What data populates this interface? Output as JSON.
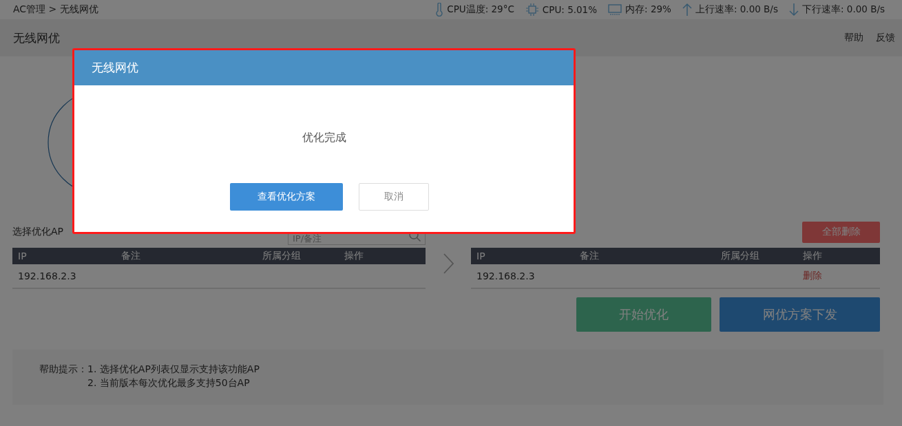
{
  "breadcrumb": "AC管理 > 无线网优",
  "status": [
    {
      "text": "CPU温度: 29°C"
    },
    {
      "text": "CPU: 5.01%"
    },
    {
      "text": "内存: 29%"
    },
    {
      "text": "上行速率: 0.00 B/s"
    },
    {
      "text": "下行速率: 0.00 B/s"
    }
  ],
  "page_title": "无线网优",
  "header_links": [
    "帮助",
    "反馈"
  ],
  "left_panel": {
    "title": "选择优化AP",
    "search": {
      "placeholder": "IP/备注"
    },
    "table": {
      "columns": [
        "IP",
        "备注",
        "所属分组",
        "操作"
      ],
      "rows": [
        {
          "ip": "192.168.2.3"
        }
      ]
    }
  },
  "right_panel": {
    "delete_all_button": "全部删除",
    "table": {
      "columns": [
        "IP",
        "备注",
        "所属分组",
        "操作"
      ],
      "rows": [
        {
          "ip": "192.168.2.3",
          "action": "删除"
        }
      ]
    }
  },
  "action_buttons": [
    {
      "label": "开始优化",
      "kind": "green"
    },
    {
      "label": "网优方案下发",
      "kind": "blue"
    }
  ],
  "help": {
    "label": "帮助提示：",
    "lines": [
      "1. 选择优化AP列表仅显示支持该功能AP",
      "2. 当前版本每次优化最多支持50台AP"
    ]
  },
  "dialog": {
    "title": "无线网优",
    "message": "优化完成",
    "primary_button": "查看优化方案",
    "cancel_button": "取消"
  }
}
